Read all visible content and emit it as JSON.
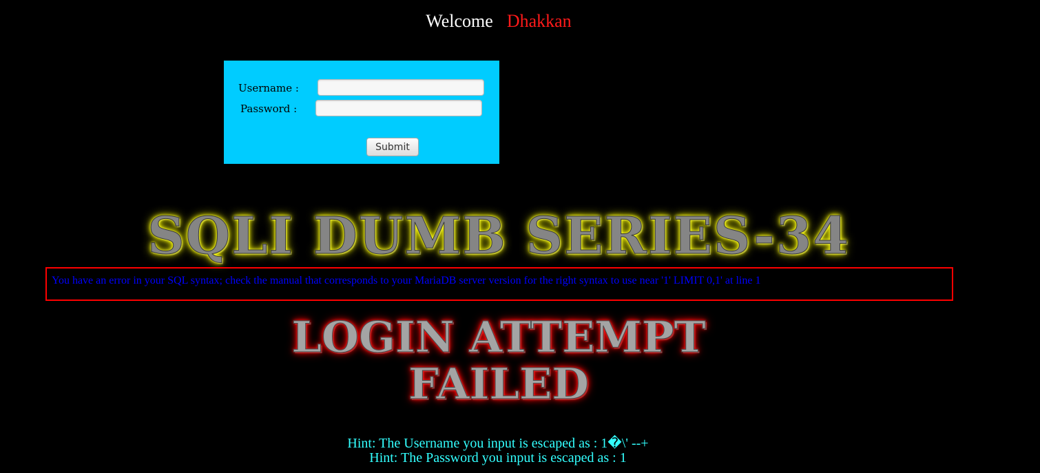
{
  "header": {
    "welcome": "Welcome",
    "username": "Dhakkan"
  },
  "form": {
    "username_label": "Username :",
    "password_label": "Password :",
    "username_value": "",
    "password_value": "",
    "submit_label": "Submit",
    "box_color": "#00ccff"
  },
  "banner": {
    "title": "SQLI DUMB SERIES-34",
    "failed_line1": "LOGIN ATTEMPT",
    "failed_line2": "FAILED"
  },
  "error": {
    "message": "You have an error in your SQL syntax; check the manual that corresponds to your MariaDB server version for the right syntax to use near '1' LIMIT 0,1' at line 1"
  },
  "hints": {
    "username_hint": "Hint: The Username you input is escaped as : 1�\\' --+",
    "password_hint": "Hint: The Password you input is escaped as : 1"
  },
  "colors": {
    "background": "#000000",
    "welcome_name": "#ff1a1a",
    "error_border": "#ff0000",
    "error_text": "#0000ff",
    "hint_text": "#33ffff"
  }
}
